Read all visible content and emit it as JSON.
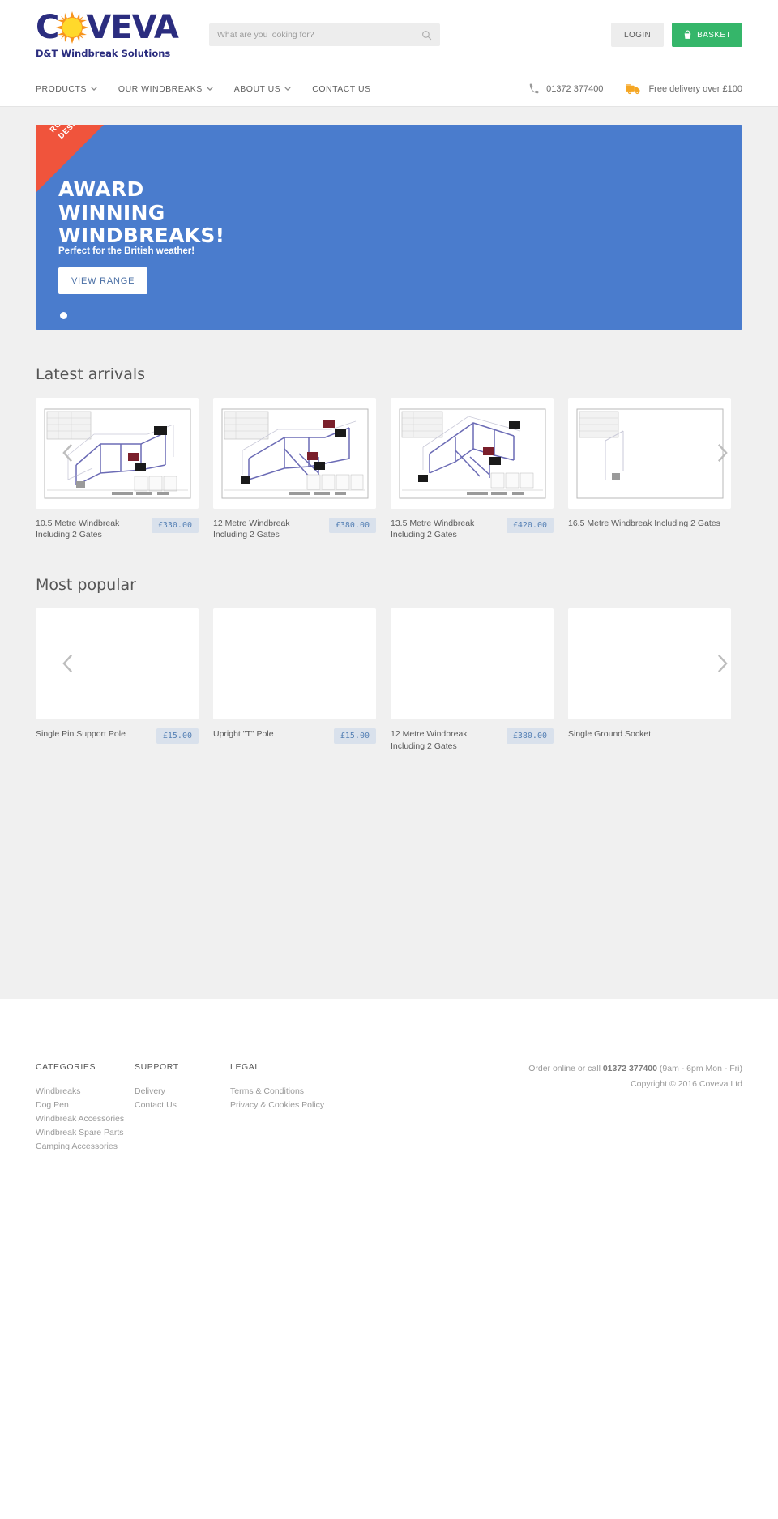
{
  "brand": {
    "name_part1": "C",
    "name_part2": "VEVA",
    "tagline": "D&T Windbreak Solutions"
  },
  "search": {
    "placeholder": "What are you looking for?",
    "value": "",
    "icon": "search-icon"
  },
  "header": {
    "login_label": "LOGIN",
    "basket_label": "BASKET",
    "basket_icon": "basket-icon",
    "accent_green": "#35b66a"
  },
  "nav": {
    "items": [
      {
        "label": "PRODUCTS",
        "has_dropdown": true
      },
      {
        "label": "OUR WINDBREAKS",
        "has_dropdown": true
      },
      {
        "label": "ABOUT US",
        "has_dropdown": true
      },
      {
        "label": "CONTACT US",
        "has_dropdown": false
      }
    ],
    "phone": "01372 377400",
    "phone_icon": "phone-icon",
    "delivery": "Free delivery over £100",
    "delivery_icon": "truck-icon"
  },
  "hero": {
    "ribbon_line1": "ROBUST",
    "ribbon_line2": "DESIGN",
    "title_line1": "AWARD",
    "title_line2": "WINNING",
    "title_line3": "WINDBREAKS!",
    "subtitle": "Perfect for the British weather!",
    "button_label": "VIEW RANGE",
    "bg_color": "#4a7ccd",
    "ribbon_color": "#f0543c",
    "slides": 1,
    "active_slide": 1
  },
  "sections": [
    {
      "title": "Latest arrivals",
      "prev_label": "previous",
      "next_label": "next",
      "products": [
        {
          "name": "10.5 Metre Windbreak Including 2 Gates",
          "price": "£330.00",
          "image": "cad-drawing"
        },
        {
          "name": "12 Metre Windbreak Including 2 Gates",
          "price": "£380.00",
          "image": "cad-drawing"
        },
        {
          "name": "13.5 Metre Windbreak Including 2 Gates",
          "price": "£420.00",
          "image": "cad-drawing"
        },
        {
          "name": "16.5 Metre Windbreak Including 2 Gates",
          "price": "",
          "image": "cad-drawing"
        }
      ]
    },
    {
      "title": "Most popular",
      "prev_label": "previous",
      "next_label": "next",
      "products": [
        {
          "name": "Single Pin Support Pole",
          "price": "£15.00",
          "image": "blank"
        },
        {
          "name": "Upright \"T\" Pole",
          "price": "£15.00",
          "image": "blank"
        },
        {
          "name": "12 Metre Windbreak Including 2 Gates",
          "price": "£380.00",
          "image": "blank"
        },
        {
          "name": "Single Ground Socket",
          "price": "",
          "image": "blank"
        }
      ]
    }
  ],
  "footer": {
    "columns": [
      {
        "heading": "CATEGORIES",
        "links": [
          "Windbreaks",
          "Dog Pen",
          "Windbreak Accessories",
          "Windbreak Spare Parts",
          "Camping Accessories"
        ]
      },
      {
        "heading": "SUPPORT",
        "links": [
          "Delivery",
          "Contact Us"
        ]
      },
      {
        "heading": "LEGAL",
        "links": [
          "Terms & Conditions",
          "Privacy & Cookies Policy"
        ]
      }
    ],
    "order_prefix": "Order online or call ",
    "order_phone": "01372 377400",
    "order_suffix": " (9am - 6pm Mon - Fri)",
    "copyright": "Copyright © 2016 Coveva Ltd"
  }
}
